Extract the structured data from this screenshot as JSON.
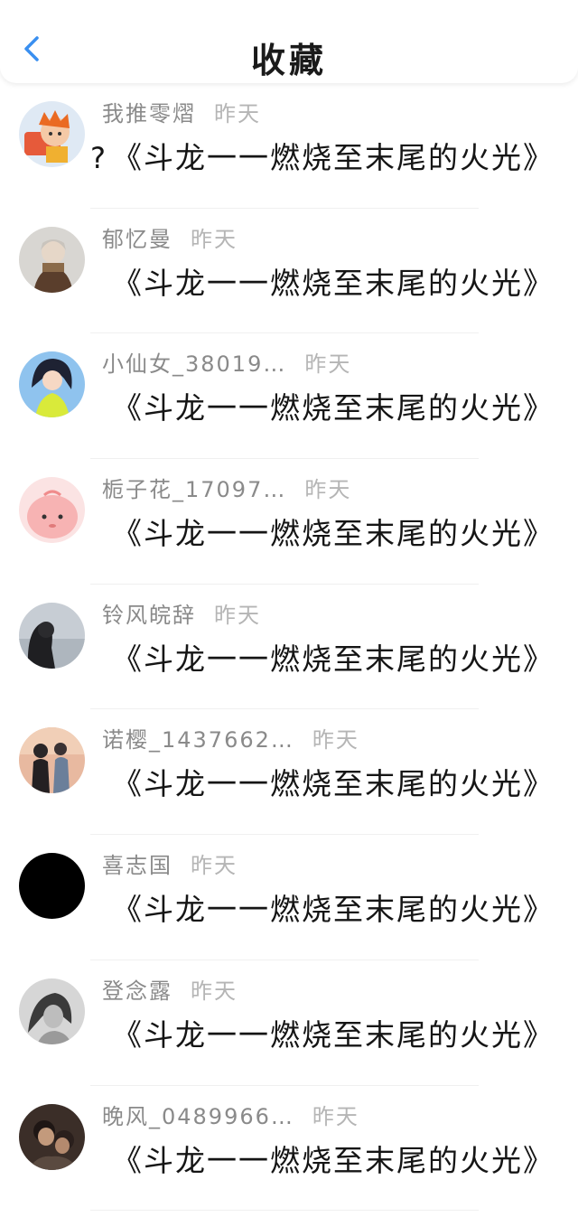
{
  "header": {
    "back_icon": "chevron-left-icon",
    "title": "收藏",
    "accent": "#3a8ff0"
  },
  "items": [
    {
      "name": "我推零熠",
      "time": "昨天",
      "prefix": "?",
      "content": "《斗龙一一燃烧至末尾的火光》"
    },
    {
      "name": "郁忆曼",
      "time": "昨天",
      "prefix": "",
      "content": "《斗龙一一燃烧至末尾的火光》"
    },
    {
      "name": "小仙女_38019…",
      "time": "昨天",
      "prefix": "",
      "content": "《斗龙一一燃烧至末尾的火光》"
    },
    {
      "name": "栀子花_17097…",
      "time": "昨天",
      "prefix": "",
      "content": "《斗龙一一燃烧至末尾的火光》"
    },
    {
      "name": "铃风皖辞",
      "time": "昨天",
      "prefix": "",
      "content": "《斗龙一一燃烧至末尾的火光》"
    },
    {
      "name": "诺樱_1437662…",
      "time": "昨天",
      "prefix": "",
      "content": "《斗龙一一燃烧至末尾的火光》"
    },
    {
      "name": "喜志国",
      "time": "昨天",
      "prefix": "",
      "content": "《斗龙一一燃烧至末尾的火光》"
    },
    {
      "name": "登念露",
      "time": "昨天",
      "prefix": "",
      "content": "《斗龙一一燃烧至末尾的火光》"
    },
    {
      "name": "晚风_0489966…",
      "time": "昨天",
      "prefix": "",
      "content": "《斗龙一一燃烧至末尾的火光》"
    }
  ]
}
